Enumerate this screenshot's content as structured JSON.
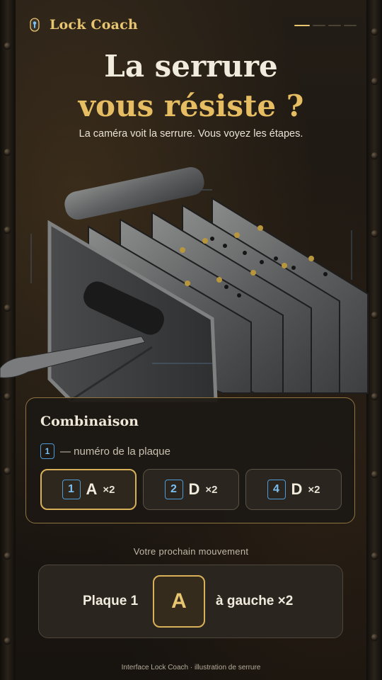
{
  "brand": {
    "name": "Lock Coach",
    "icon": "keyhole-icon"
  },
  "progress": {
    "total": 4,
    "current": 1
  },
  "hero": {
    "line1": "La serrure",
    "line2": "vous résiste ?"
  },
  "subtitle": "La caméra voit la serrure. Vous voyez les étapes.",
  "combination": {
    "title": "Combinaison",
    "legend_number": "1",
    "legend_text": "— numéro de la plaque",
    "steps": [
      {
        "plate": "1",
        "letter": "A",
        "times": "×2",
        "active": true
      },
      {
        "plate": "2",
        "letter": "D",
        "times": "×2",
        "active": false
      },
      {
        "plate": "4",
        "letter": "D",
        "times": "×2",
        "active": false
      }
    ]
  },
  "next_move": {
    "label": "Votre prochain mouvement",
    "plate": "Plaque 1",
    "letter": "A",
    "direction": "à gauche ×2"
  },
  "footer": "Interface Lock Coach · illustration de serrure",
  "colors": {
    "accent": "#e8c571",
    "number": "#4f9bd8",
    "background": "#1c1712"
  }
}
